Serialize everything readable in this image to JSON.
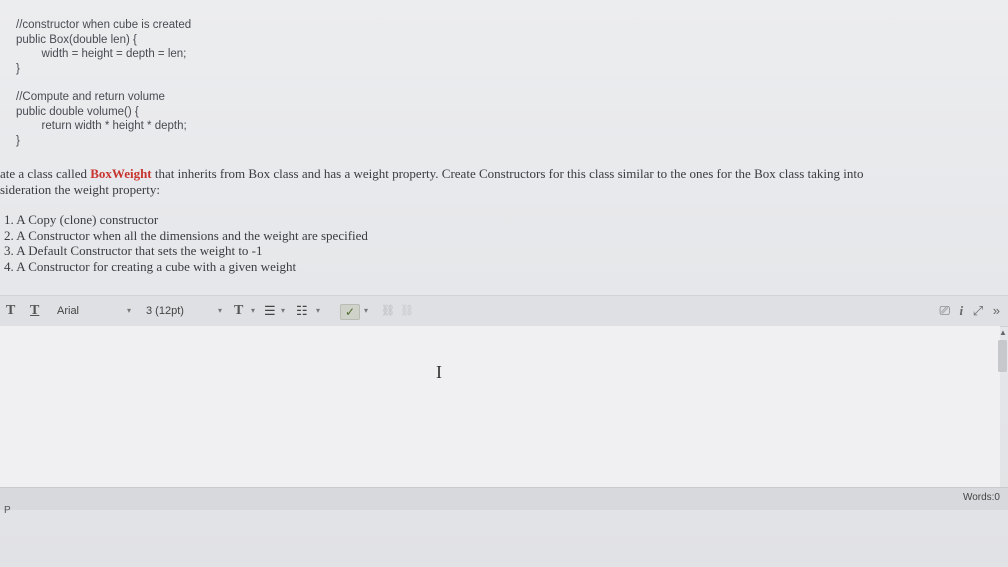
{
  "code": {
    "lines": [
      "//constructor when cube is created",
      "public Box(double len) {",
      "        width = height = depth = len;",
      "}",
      "",
      "//Compute and return volume",
      "public double volume() {",
      "        return width * height * depth;",
      "}"
    ]
  },
  "question": {
    "line1_prefix": "ate a class called ",
    "class_name": "BoxWeight",
    "line1_suffix": " that inherits from Box class and has a weight property. Create Constructors for this class similar to the ones for the Box class taking into",
    "line2": "sideration the weight property:",
    "items": [
      "1. A Copy (clone) constructor",
      "2. A Constructor when all the dimensions and the weight are specified",
      "3. A Default Constructor that sets the weight to -1",
      "4. A Constructor for creating a cube with a given weight"
    ]
  },
  "toolbar": {
    "text_color_btn": "T",
    "bg_color_btn": "T",
    "font_family": "Arial",
    "font_size": "3 (12pt)",
    "format_btn": "T",
    "ul_btn": "☰",
    "ol_btn": "☷",
    "caret": "▾",
    "spell_icon": "✓",
    "link_icon": "⛓",
    "unlink_icon": "⛓",
    "preview_icon": "⎚",
    "info_icon": "i",
    "fullscreen_icon": "⤢",
    "collapse_icon": "»"
  },
  "editor": {
    "cursor": "I"
  },
  "statusbar": {
    "path": "P",
    "words": "Words:0"
  },
  "colors": {
    "class_name": "#c8342f",
    "background": "#e4e4e6"
  }
}
